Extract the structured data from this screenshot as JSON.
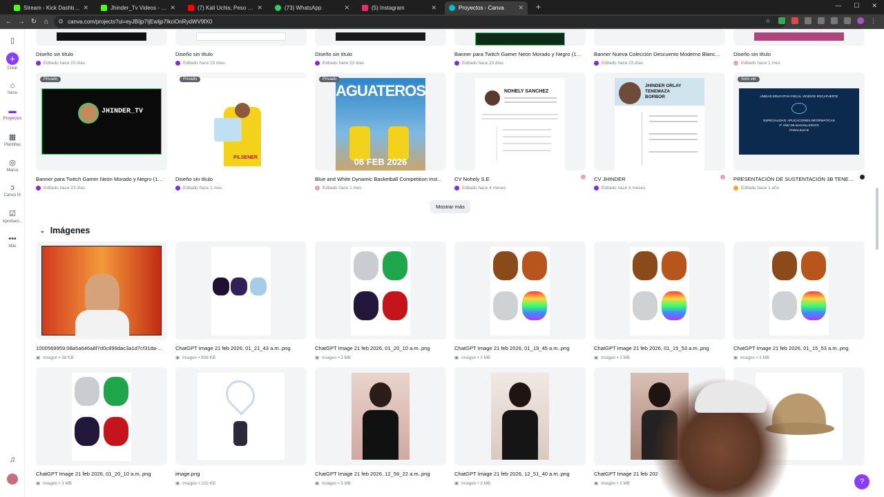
{
  "browser": {
    "tabs": [
      {
        "title": "Stream - Kick Dashboard",
        "color": "#53fc18"
      },
      {
        "title": "Jhinder_Tv Videos - Watch On",
        "color": "#53fc18"
      },
      {
        "title": "(7) Kali Uchis, Peso Pluma",
        "color": "#ff0000"
      },
      {
        "title": "(73) WhatsApp",
        "color": "#25d366"
      },
      {
        "title": "(5) Instagram",
        "color": "#e1306c"
      },
      {
        "title": "Proyectos - Canva",
        "color": "#00c4cc"
      }
    ],
    "url": "canva.com/projects?ui=eyJBIjp7IjEwIjp7IkciOnRydWV9fX0"
  },
  "sidebar": {
    "items": [
      {
        "label": "Crear",
        "icon": "plus-icon"
      },
      {
        "label": "Inicio",
        "icon": "home-icon"
      },
      {
        "label": "Proyectos",
        "icon": "folder-icon"
      },
      {
        "label": "Plantillas",
        "icon": "templates-icon"
      },
      {
        "label": "Marca",
        "icon": "brand-icon"
      },
      {
        "label": "Canva IA",
        "icon": "ai-icon"
      },
      {
        "label": "Aprobaci...",
        "icon": "approval-icon"
      },
      {
        "label": "Más",
        "icon": "more-icon"
      }
    ]
  },
  "designs_row1": [
    {
      "title": "Diseño sin título",
      "meta": "Editado hace 23 días"
    },
    {
      "title": "Diseño sin título",
      "meta": "Editado hace 23 días"
    },
    {
      "title": "Diseño sin título",
      "meta": "Editado hace 23 días"
    },
    {
      "title": "Banner para Twitch Gamer Neón Morado y Negro (12...",
      "meta": "Editado hace 23 días"
    },
    {
      "title": "Banner Nueva Colección Descuento Moderno Blanco...",
      "meta": "Editado hace 23 días"
    },
    {
      "title": "Diseño sin título",
      "meta": "Editado hace 1 mes"
    }
  ],
  "designs_row2": [
    {
      "title": "Banner para Twitch Gamer Neón Morado y Negro (12...",
      "meta": "Editado hace 23 días",
      "badge": "Privado"
    },
    {
      "title": "Diseño sin título",
      "meta": "Editado hace 1 mes",
      "badge": "Privado"
    },
    {
      "title": "Blue and White Dynamic Basketball Competition Inst...",
      "meta": "Editado hace 1 mes",
      "badge": "Privado"
    },
    {
      "title": "CV Nohely S.E",
      "meta": "Editado hace 4 meses",
      "badge": ""
    },
    {
      "title": "CV JHINDER",
      "meta": "Editado hace 6 meses",
      "badge": ""
    },
    {
      "title": "PRESENTACIÓN DE SUSTENTACIÓN 3B TENEMAZA...",
      "meta": "Editado hace 1 año",
      "badge": "Solo ver"
    }
  ],
  "thumb_text": {
    "jhinder": "JHINDER_TV",
    "aguateros": "AGUATEROS",
    "aguateros_date": "06 FEB 2026",
    "cv_nohely": "NOHELY SANCHEZ",
    "cv_jhinder_1": "JHINDER ORLAY",
    "cv_jhinder_2": "TENEMAZA",
    "cv_jhinder_3": "BORBOR",
    "pres_1": "UNIDAD EDUCATIVA FISCAL VICENTE ROCAFUERTE",
    "pres_2": "ESPECIALIDAD: APLICACIONES INFORMÁTICAS",
    "pres_3": "3° AÑO DE BACHILLERATO",
    "pres_4": "PARALELO B",
    "pilsener": "PILSENER"
  },
  "show_more": "Mostrar más",
  "images_section": "Imágenes",
  "images_row1": [
    {
      "title": "1000569959:08a5a646a8f7d0c899dac3a1d7cf31da-...",
      "meta": "Imagen • 38 KB"
    },
    {
      "title": "ChatGPT Image 21 feb 2026, 01_21_43 a.m..png",
      "meta": "Imagen • 808 KB"
    },
    {
      "title": "ChatGPT Image 21 feb 2026, 01_20_10 a.m..png",
      "meta": "Imagen • 3 MB"
    },
    {
      "title": "ChatGPT Image 21 feb 2026, 01_19_45 a.m..png",
      "meta": "Imagen • 3 MB"
    },
    {
      "title": "ChatGPT Image 21 feb 2026, 01_15_53 a.m..png",
      "meta": "Imagen • 3 MB"
    },
    {
      "title": "ChatGPT Image 21 feb 2026, 01_15_53 a.m..png",
      "meta": "Imagen • 3 MB"
    }
  ],
  "images_row2": [
    {
      "title": "ChatGPT Image 21 feb 2026, 01_20_10 a.m..png",
      "meta": "Imagen • 3 MB"
    },
    {
      "title": "image.png",
      "meta": "Imagen • 102 KB"
    },
    {
      "title": "ChatGPT Image 21 feb 2026, 12_56_22 a.m..png",
      "meta": "Imagen • 3 MB"
    },
    {
      "title": "ChatGPT Image 21 feb 2026, 12_51_40 a.m..png",
      "meta": "Imagen • 3 MB"
    },
    {
      "title": "ChatGPT Image 21 feb 202",
      "meta": "Imagen • 3 MB"
    }
  ],
  "colors": {
    "accent": "#8b3dff",
    "projects": "#7d2ae8"
  }
}
